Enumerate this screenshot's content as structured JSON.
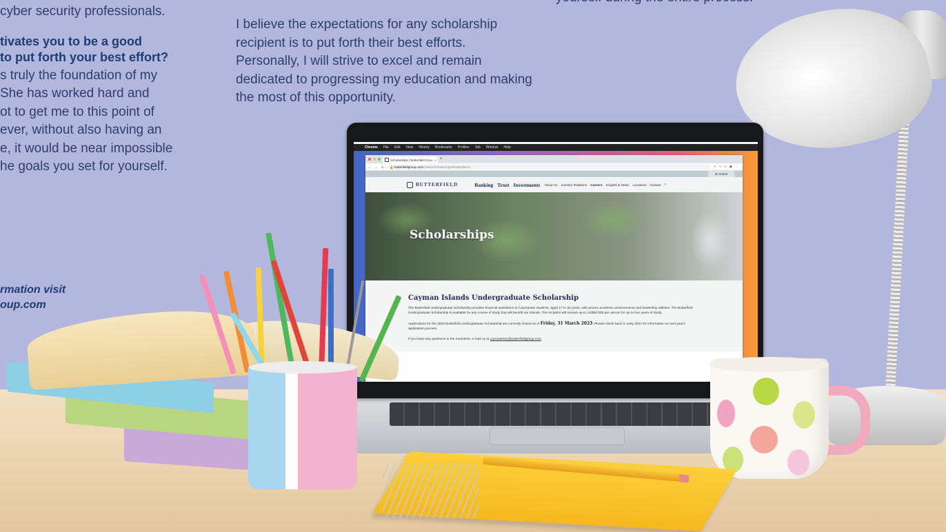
{
  "background": {
    "left_text": {
      "line1": "cyber security professionals.",
      "question": "tivates you to be a good\nto put forth your best effort?",
      "answer": "s truly the foundation of my\nShe has worked hard and\not to get me to this point of\never, without also having an\ne, it would be near impossible\nhe goals you set for yourself.",
      "visit": "rmation visit\noup.com"
    },
    "middle_text": "I believe the expectations for any scholarship recipient is to put forth their best efforts. Personally, I will strive to excel and remain dedicated to progressing my education and making the most of this opportunity.",
    "right_text": "yourself during the entire process."
  },
  "mac_menubar": {
    "apple": "",
    "app": "Chrome",
    "items": [
      "File",
      "Edit",
      "View",
      "History",
      "Bookmarks",
      "Profiles",
      "Tab",
      "Window",
      "Help"
    ]
  },
  "browser": {
    "tab_title": "Scholarships | Butterfield Grou",
    "tab_close": "×",
    "new_tab": "+",
    "url_domain": "butterfieldgroup.com",
    "url_path": "/careers/scholarships#butterfield-4",
    "region": "Global",
    "region_icon": "globe-icon"
  },
  "site": {
    "logo": "BUTTERFIELD",
    "nav_primary": [
      "Banking",
      "Trust",
      "Investments"
    ],
    "nav_secondary": [
      "About Us",
      "Investor Relations",
      "Careers",
      "Insights & News",
      "Locations",
      "Contact"
    ],
    "active_nav": "Careers",
    "hero_title": "Scholarships",
    "heading": "Cayman Islands Undergraduate Scholarship",
    "para1": "The Butterfield Undergraduate Scholarship provides financial assistance to Caymanian students, aged 17 to 25 years, with proven academic achievements and leadership abilities. The Butterfield Undergraduate Scholarship is available for any course of study that will benefit our islands. The recipient will receive up to US$30,000 per annum for up to four years of study.",
    "para2_before": "Applications for the 2023 Butterfield Undergraduate Scholarship are currently closed as of ",
    "para2_date": "Friday, 31 March 2023",
    "para2_after": ". Please check back in early 2024 for information on next year's application process.",
    "para3_before": "If you have any questions in the meantime, e-mail us at ",
    "para3_email": "caystudents@butterfieldgroup.com"
  },
  "colors": {
    "background": "#b3b7dd",
    "text_navy": "#2c3f6b",
    "brand_navy": "#1f2c52"
  }
}
